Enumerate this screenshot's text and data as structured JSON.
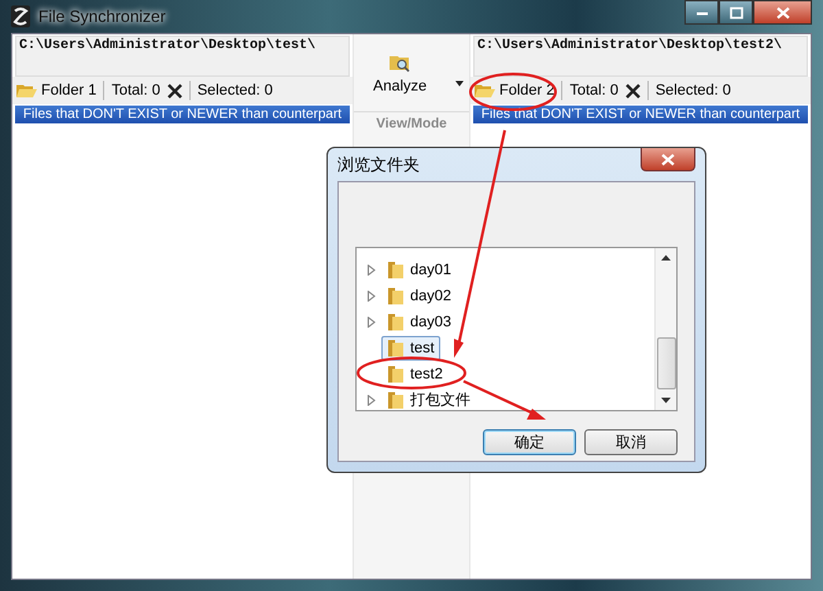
{
  "window": {
    "title": "File Synchronizer"
  },
  "panels": [
    {
      "path": "C:\\Users\\Administrator\\Desktop\\test\\",
      "folder_button": "Folder 1",
      "total": "Total: 0",
      "selected_count": "Selected: 0",
      "header": "Files that DON'T EXIST or NEWER than counterpart"
    },
    {
      "path": "C:\\Users\\Administrator\\Desktop\\test2\\",
      "folder_button": "Folder 2",
      "total": "Total: 0",
      "selected_count": "Selected: 0",
      "header": "Files that DON'T EXIST or NEWER than counterpart"
    }
  ],
  "toolbar": {
    "analyze_button": "Analyze",
    "view_mode_label": "View/Mode"
  },
  "dialog": {
    "title": "浏览文件夹",
    "tree": [
      {
        "label": "day01",
        "expandable": true,
        "selected": false
      },
      {
        "label": "day02",
        "expandable": true,
        "selected": false
      },
      {
        "label": "day03",
        "expandable": true,
        "selected": false
      },
      {
        "label": "test",
        "expandable": false,
        "selected": true
      },
      {
        "label": "test2",
        "expandable": false,
        "selected": false
      },
      {
        "label": "打包文件",
        "expandable": true,
        "selected": false
      }
    ],
    "buttons": [
      {
        "label": "确定",
        "default": true
      },
      {
        "label": "取消",
        "default": false
      }
    ]
  }
}
